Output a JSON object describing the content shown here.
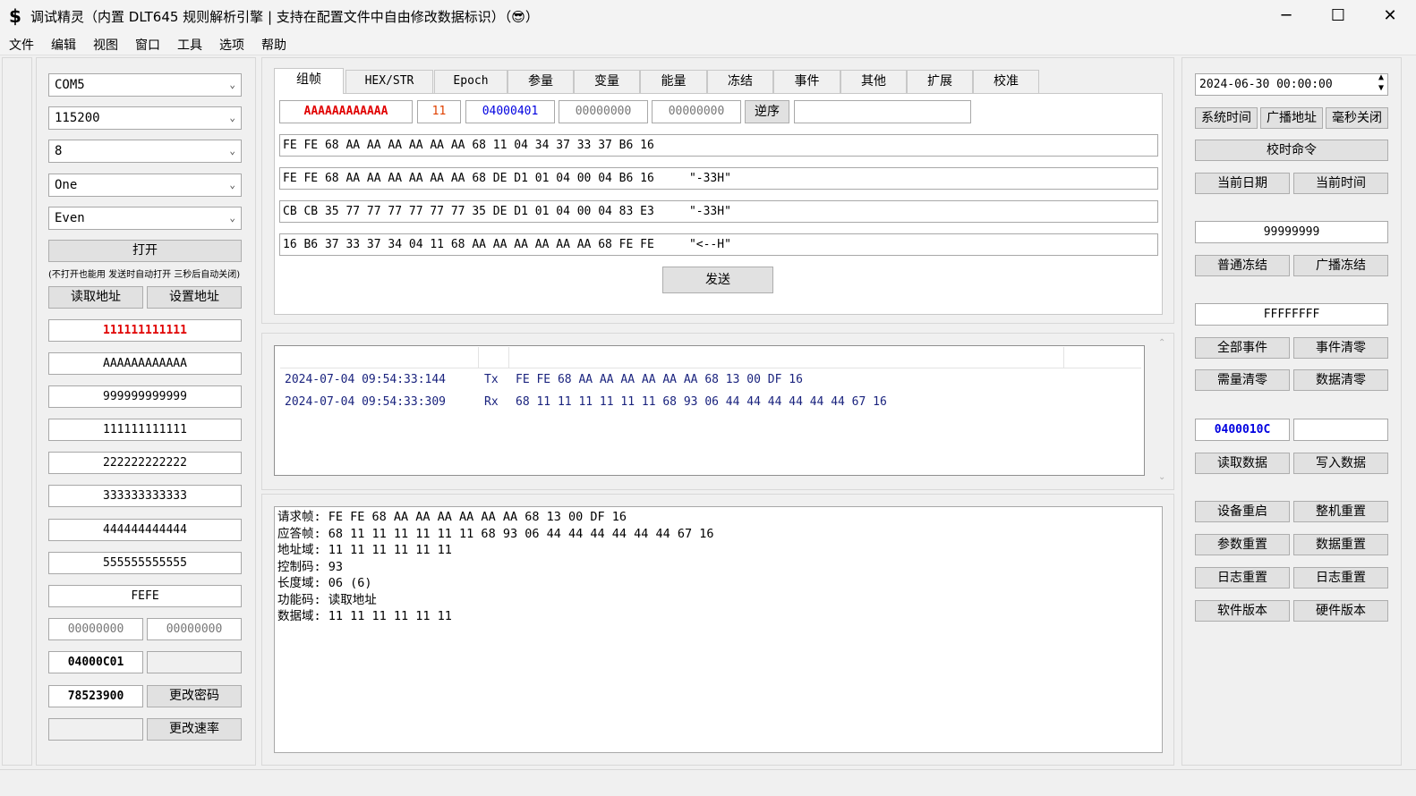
{
  "window": {
    "title": "调试精灵（内置 DLT645 规则解析引擎 | 支持在配置文件中自由修改数据标识）（😎）",
    "icon_glyph": "$",
    "minimize": "─",
    "maximize": "☐",
    "close": "✕"
  },
  "menu": [
    "文件",
    "编辑",
    "视图",
    "窗口",
    "工具",
    "选项",
    "帮助"
  ],
  "left": {
    "port": "COM5",
    "baud": "115200",
    "databits": "8",
    "stopbits": "One",
    "parity": "Even",
    "open_label": "打开",
    "hint": "(不打开也能用 发送时自动打开 三秒后自动关闭)",
    "read_addr_label": "读取地址",
    "set_addr_label": "设置地址",
    "addresses": [
      "111111111111",
      "AAAAAAAAAAAA",
      "999999999999",
      "111111111111",
      "222222222222",
      "333333333333",
      "444444444444",
      "555555555555",
      "FEFE"
    ],
    "pwd1": "00000000",
    "pwd2": "00000000",
    "id_value": "04000C01",
    "id_blank": "",
    "password": "78523900",
    "change_pwd_label": "更改密码",
    "rate_blank": "",
    "change_rate_label": "更改速率"
  },
  "tabs": [
    "组帧",
    "HEX/STR",
    "Epoch",
    "参量",
    "变量",
    "能量",
    "冻结",
    "事件",
    "其他",
    "扩展",
    "校准"
  ],
  "frame": {
    "addr": "AAAAAAAAAAAA",
    "ctrl": "11",
    "di": "04000401",
    "f1": "00000000",
    "f2": "00000000",
    "reverse_label": "逆序",
    "extra": "",
    "lines": [
      "FE FE 68 AA AA AA AA AA AA 68 11 04 34 37 33 37 B6 16",
      "FE FE 68 AA AA AA AA AA AA 68 DE D1 01 04 00 04 B6 16     \"-33H\"",
      "CB CB 35 77 77 77 77 77 77 35 DE D1 01 04 00 04 83 E3     \"-33H\"",
      "16 B6 37 33 37 34 04 11 68 AA AA AA AA AA AA 68 FE FE     \"<--H\""
    ],
    "send_label": "发送"
  },
  "log": [
    {
      "time": "2024-07-04 09:54:33:144",
      "dir": "Tx",
      "data": "FE FE 68 AA AA AA AA AA AA 68 13 00 DF 16"
    },
    {
      "time": "2024-07-04 09:54:33:309",
      "dir": "Rx",
      "data": "68 11 11 11 11 11 11 68 93 06 44 44 44 44 44 44 67 16"
    }
  ],
  "parse": [
    "请求帧: FE FE 68 AA AA AA AA AA AA 68 13 00 DF 16",
    "应答帧: 68 11 11 11 11 11 11 68 93 06 44 44 44 44 44 44 67 16",
    "地址域: 11 11 11 11 11 11",
    "控制码: 93",
    "长度域: 06 (6)",
    "功能码: 读取地址",
    "数据域: 11 11 11 11 11 11"
  ],
  "right": {
    "datetime": "2024-06-30 00:00:00",
    "sys_time": "系统时间",
    "broadcast_addr": "广播地址",
    "ms_close": "毫秒关闭",
    "time_cmd": "校时命令",
    "cur_date": "当前日期",
    "cur_time": "当前时间",
    "freeze_value": "99999999",
    "normal_freeze": "普通冻结",
    "broadcast_freeze": "广播冻结",
    "event_value": "FFFFFFFF",
    "all_events": "全部事件",
    "event_clear": "事件清零",
    "demand_clear": "需量清零",
    "data_clear": "数据清零",
    "data_id": "0400010C",
    "data_value": "",
    "read_data": "读取数据",
    "write_data": "写入数据",
    "device_restart": "设备重启",
    "machine_reset": "整机重置",
    "param_reset": "参数重置",
    "data_reset": "数据重置",
    "log_reset1": "日志重置",
    "log_reset2": "日志重置",
    "sw_version": "软件版本",
    "hw_version": "硬件版本"
  }
}
